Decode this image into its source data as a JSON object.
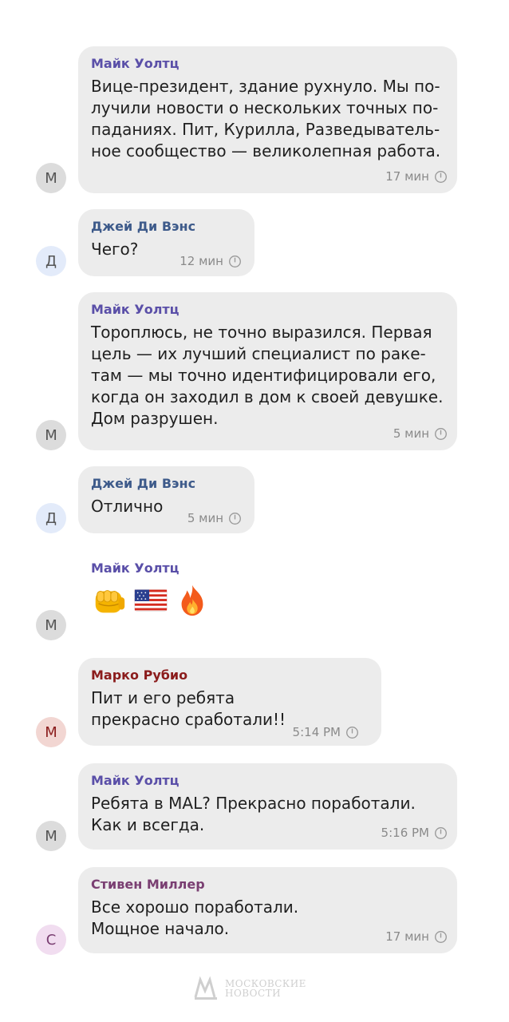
{
  "colors": {
    "bubble_bg": "#ececec",
    "mike_name": "#5a4fa8",
    "jd_name": "#3d5a8a",
    "marco_name": "#8b1c1c",
    "stephen_name": "#7a3f72",
    "time_text": "#8a8a8a"
  },
  "messages": [
    {
      "avatar": "М",
      "sender": "Майк Уолтц",
      "text": "Вице-президент, здание рухнуло. Мы по-\nлучили новости о нескольких точных по-\nпаданиях. Пит, Курилла, Разведыватель-\nное сообщество — великолепная работа.",
      "time": "17 мин"
    },
    {
      "avatar": "Д",
      "sender": "Джей Ди Вэнс",
      "text": "Чего?",
      "time": "12 мин"
    },
    {
      "avatar": "М",
      "sender": "Майк Уолтц",
      "text": "Тороплюсь, не точно выразился. Первая\nцель — их лучший специалист по раке-\nтам — мы точно идентифицировали его,\nкогда он заходил в дом к своей девушке.\nДом разрушен.",
      "time": "5 мин"
    },
    {
      "avatar": "Д",
      "sender": "Джей Ди Вэнс",
      "text": "Отлично",
      "time": "5 мин"
    },
    {
      "avatar": "М",
      "sender": "Майк Уолтц",
      "emojis": [
        "fist-emoji",
        "us-flag-emoji",
        "fire-emoji"
      ]
    },
    {
      "avatar": "М",
      "sender": "Марко Рубио",
      "text": "Пит и его ребята\nпрекрасно сработали!!",
      "time": "5:14 PM"
    },
    {
      "avatar": "М",
      "sender": "Майк Уолтц",
      "text": "Ребята в MAL? Прекрасно поработали.\nКак и всегда.",
      "time": "5:16 PM"
    },
    {
      "avatar": "С",
      "sender": "Стивен Миллер",
      "text": "Все хорошо поработали.\nМощное начало.",
      "time": "17 мин"
    }
  ],
  "watermark": {
    "line1": "МОСКОВСКИЕ",
    "line2": "НОВОСТИ"
  }
}
